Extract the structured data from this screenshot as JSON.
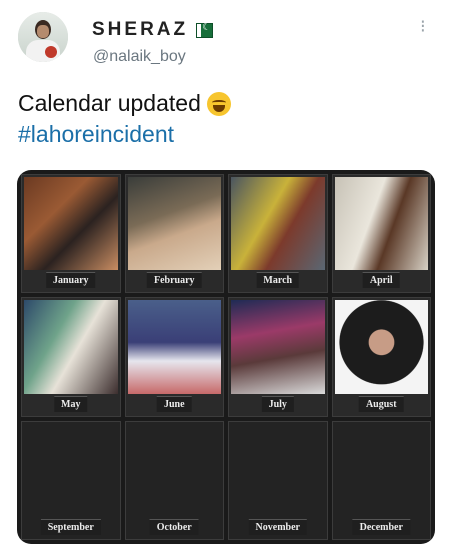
{
  "user": {
    "display_name": "SHERAZ",
    "handle": "@nalaik_boy"
  },
  "tweet": {
    "line1": "Calendar updated",
    "hashtag": "#lahoreincident",
    "emoji": "laughing-with-tears-emoji"
  },
  "menu": {
    "icon": "more-options-icon",
    "glyph": "⁝"
  },
  "colors": {
    "hashtag": "#1b6fa8",
    "flag_green": "#176e3a"
  },
  "calendar": {
    "months": [
      "January",
      "February",
      "March",
      "April",
      "May",
      "June",
      "July",
      "August",
      "September",
      "October",
      "November",
      "December"
    ]
  }
}
